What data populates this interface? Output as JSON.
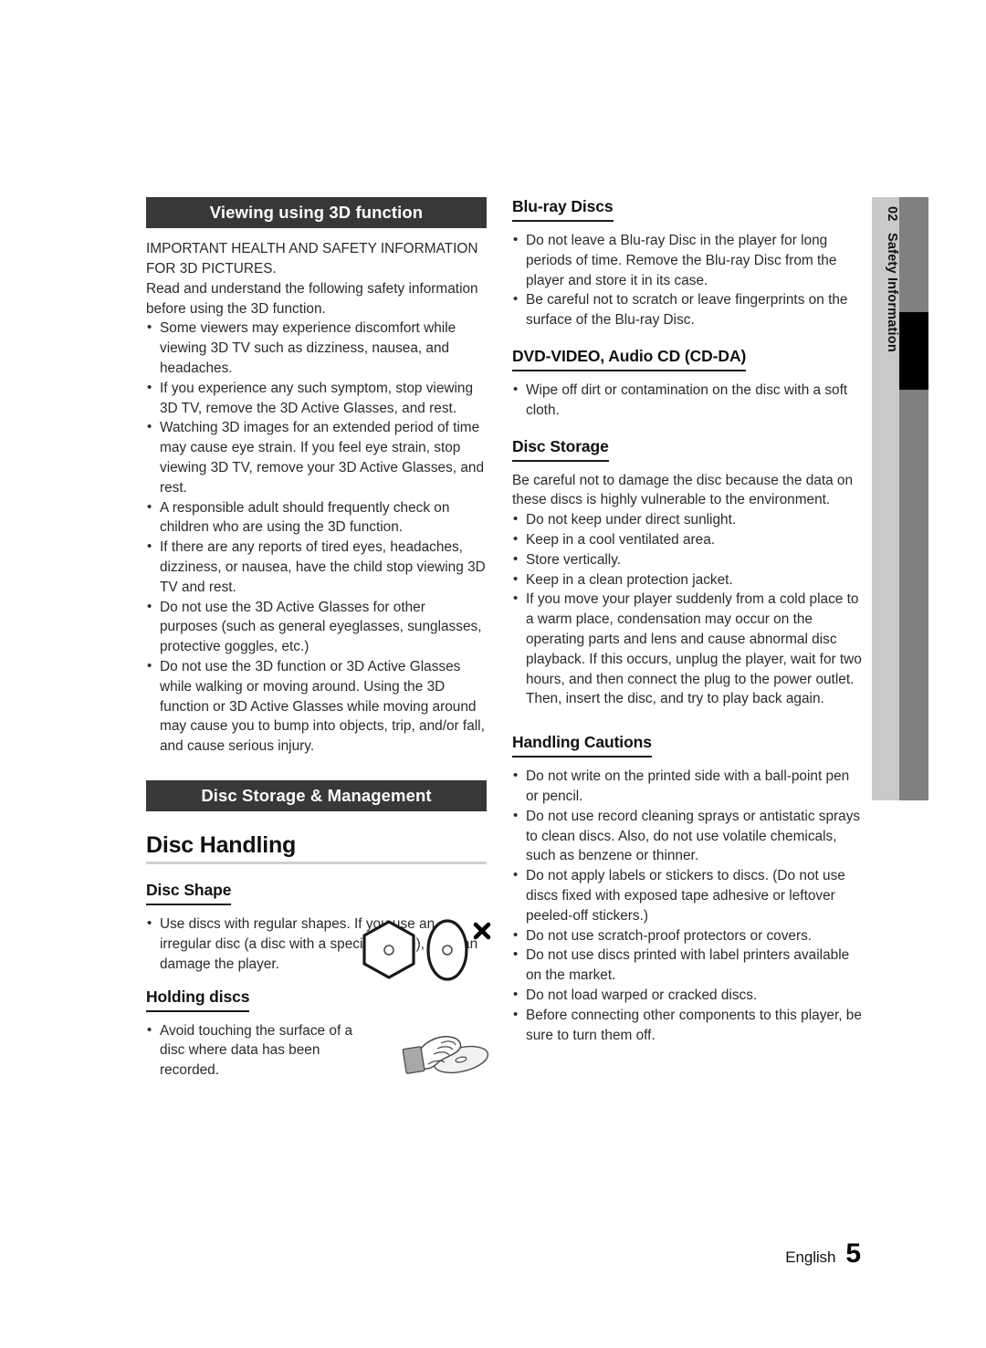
{
  "page": {
    "footer_language": "English",
    "footer_page_number": "5",
    "side_tab_number": "02",
    "side_tab_label": "Safety Information",
    "colors": {
      "banner_bg": "#383838",
      "side_tab_light": "#c9c9c9",
      "side_tab_dark": "#808080",
      "side_tab_marker": "#000000",
      "rule": "#cfcfcf",
      "text": "#2b2b2b"
    }
  },
  "left_column": {
    "banner_3d": "Viewing using 3D function",
    "intro": {
      "line1": "IMPORTANT HEALTH AND SAFETY INFORMATION FOR 3D PICTURES.",
      "line2": "Read and understand the following safety information before using the 3D function."
    },
    "bullets_3d": [
      {
        "text": "Some viewers may experience discomfort while viewing 3D TV such as dizziness, nausea, and headaches.",
        "sub": "If you experience any such symptom, stop viewing 3D TV, remove the 3D Active Glasses, and rest."
      },
      {
        "text": "Watching 3D images for an extended period of time may cause eye strain. If you feel eye strain, stop viewing 3D TV, remove your 3D Active Glasses, and rest.",
        "sub": ""
      },
      {
        "text": "A responsible adult should frequently check on children who are using the 3D function.",
        "sub": "If there are any reports of tired eyes, headaches, dizziness, or nausea, have the child stop viewing 3D TV and rest."
      },
      {
        "text": "Do not use the 3D Active Glasses for other purposes (such as general eyeglasses, sunglasses, protective goggles, etc.)",
        "sub": ""
      },
      {
        "text": "Do not use the 3D function or 3D Active Glasses while walking or moving around. Using the 3D function or 3D Active Glasses while moving around may cause you to bump into objects, trip, and/or fall, and cause serious injury.",
        "sub": ""
      }
    ],
    "banner_storage": "Disc Storage & Management",
    "disc_handling_title": "Disc Handling",
    "disc_shape": {
      "heading": "Disc Shape",
      "bullet": "Use discs with regular shapes. If you use an irregular disc (a disc with a special shape), you can damage the player."
    },
    "holding_discs": {
      "heading": "Holding discs",
      "bullet": "Avoid touching the surface of a disc where data has been recorded."
    }
  },
  "right_column": {
    "bluray": {
      "heading": "Blu-ray Discs",
      "bullets": [
        "Do not leave a Blu-ray Disc in the player for long periods of time. Remove the Blu-ray Disc from the player and store it in its case.",
        "Be careful not to scratch or leave fingerprints on the surface of the Blu-ray Disc."
      ]
    },
    "dvd_audio": {
      "heading": "DVD-VIDEO, Audio CD (CD-DA)",
      "bullets": [
        "Wipe off dirt or contamination on the disc with a soft cloth."
      ]
    },
    "disc_storage": {
      "heading": "Disc Storage",
      "intro": "Be careful not to damage the disc because the data on these discs is highly vulnerable to the environment.",
      "bullets": [
        "Do not keep under direct sunlight.",
        "Keep in a cool ventilated area.",
        "Store vertically.",
        "Keep in a clean protection jacket.",
        "If you move your player suddenly from a cold place to a warm place, condensation may occur on the operating parts and lens and cause abnormal disc playback. If this occurs, unplug the player, wait for two hours, and then connect the plug to the power outlet. Then, insert the disc, and try to play back again."
      ]
    },
    "handling_cautions": {
      "heading": "Handling Cautions",
      "bullets": [
        "Do not write on the printed side with a ball-point pen or pencil.",
        "Do not use record cleaning sprays or antistatic sprays to clean discs. Also, do not use volatile chemicals, such as benzene or thinner.",
        "Do not apply labels or stickers to discs. (Do not use discs fixed with exposed tape adhesive or leftover peeled-off stickers.)",
        "Do not use scratch-proof protectors or covers.",
        "Do not use discs printed with label printers available on the market.",
        "Do not load warped or cracked discs.",
        "Before connecting other components to this player, be sure to turn them off."
      ]
    }
  }
}
